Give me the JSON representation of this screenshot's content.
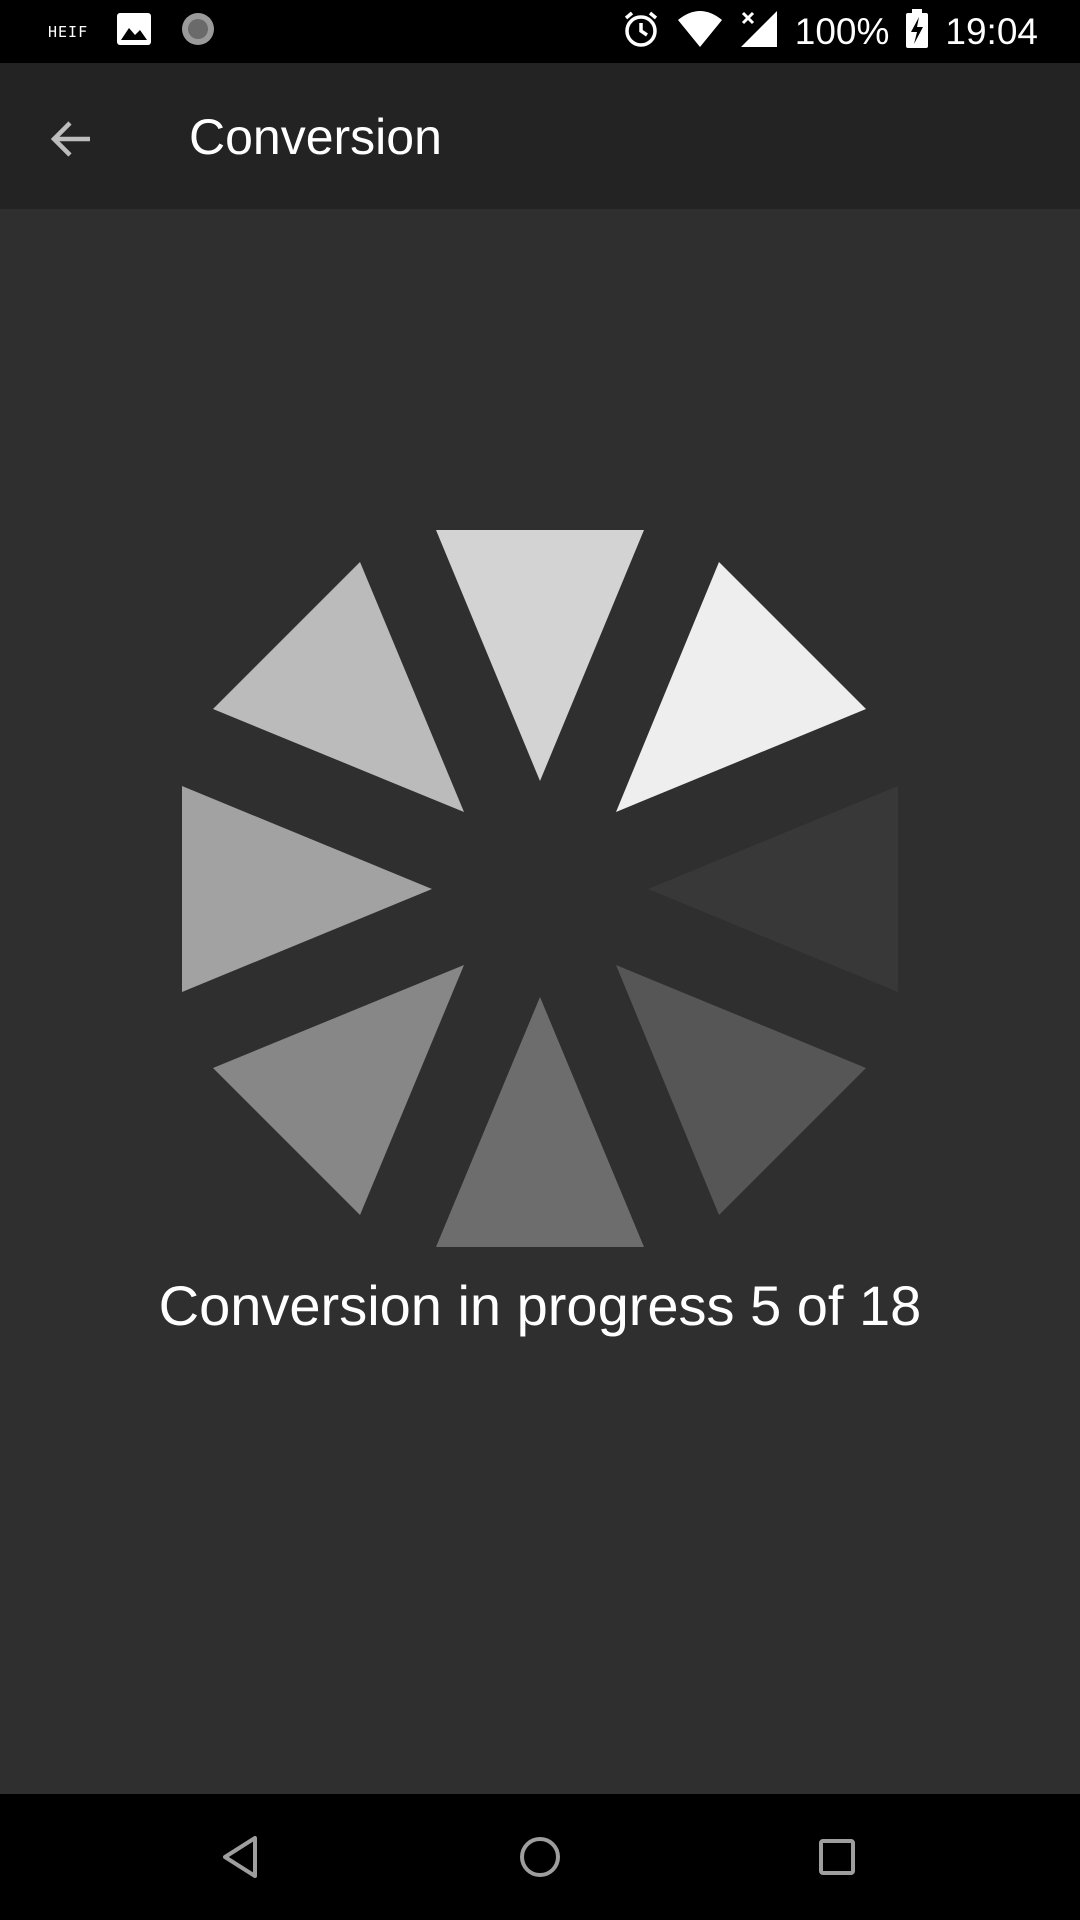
{
  "status_bar": {
    "left_icons": [
      "heif-notification-icon",
      "image-icon",
      "spinner-notification-icon"
    ],
    "heif_label": "HEIF",
    "right_icons": [
      "alarm-icon",
      "wifi-icon",
      "no-signal-icon",
      "battery-charging-icon"
    ],
    "battery_percent": "100%",
    "time": "19:04"
  },
  "app_bar": {
    "title": "Conversion",
    "back_icon": "arrow-back-icon"
  },
  "main": {
    "spinner_icon": "loading-spinner-icon",
    "progress_label": "Conversion in progress 5 of 18",
    "progress_current": 5,
    "progress_total": 18
  },
  "nav_bar": {
    "icons": [
      "nav-back-icon",
      "nav-home-icon",
      "nav-recents-icon"
    ]
  },
  "colors": {
    "status_bar_bg": "#000000",
    "app_bar_bg": "#232323",
    "content_bg": "#2f2f2f",
    "nav_bar_bg": "#000000",
    "text_primary": "#ffffff"
  }
}
